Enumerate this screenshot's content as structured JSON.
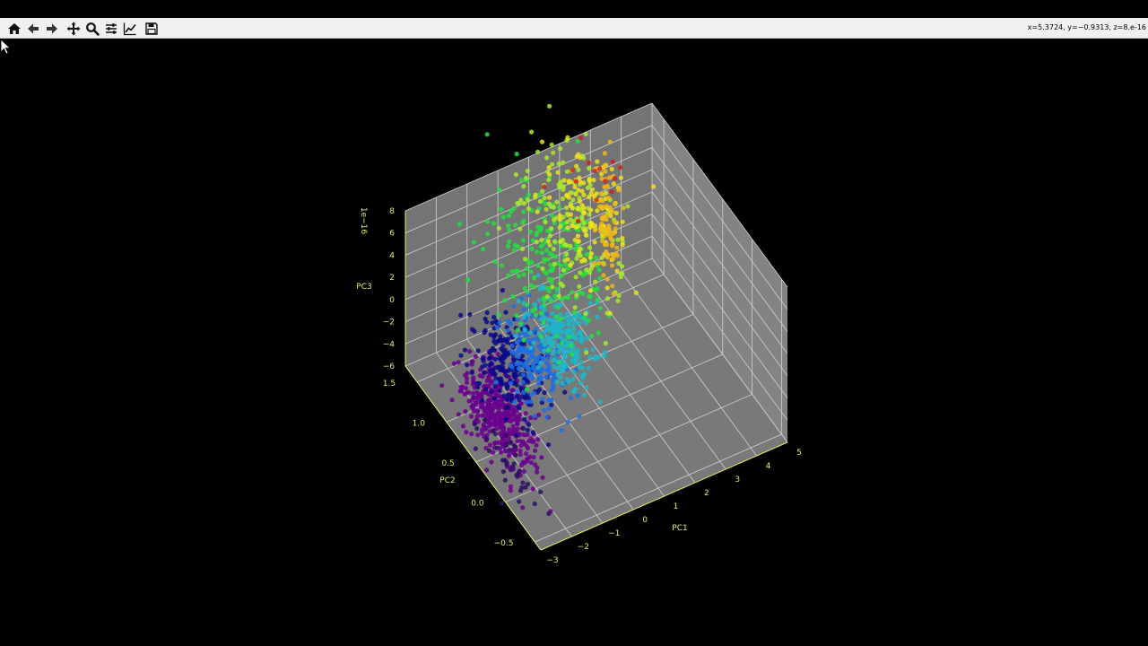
{
  "toolbar": {
    "buttons": [
      {
        "name": "home-icon"
      },
      {
        "name": "back-arrow-icon"
      },
      {
        "name": "forward-arrow-icon"
      },
      {
        "name": "pan-move-icon"
      },
      {
        "name": "zoom-magnifier-icon"
      },
      {
        "name": "configure-subplots-icon"
      },
      {
        "name": "edit-axes-icon"
      },
      {
        "name": "save-floppy-icon"
      }
    ],
    "coords": "x=5.3724, y=−0.9313, z=8.e-16"
  },
  "colors": {
    "axis_text": "#e8e86a",
    "pane": "#808080",
    "grid": "#c8c8c8",
    "background": "#000000",
    "toolbar_bg": "#f0f0f0"
  },
  "chart_data": {
    "type": "scatter",
    "dimensions": 3,
    "xlabel": "PC1",
    "ylabel": "PC2",
    "zlabel": "PC3",
    "z_offset_label": "1e−16",
    "xlim": [
      -3,
      5
    ],
    "ylim": [
      -0.6,
      1.7
    ],
    "zlim": [
      -6,
      8
    ],
    "grid": true,
    "x_ticks": [
      "−3",
      "−2",
      "−1",
      "0",
      "1",
      "2",
      "3",
      "4",
      "5"
    ],
    "y_ticks": [
      "−0.5",
      "0.0",
      "0.5",
      "1.0",
      "1.5"
    ],
    "z_ticks": [
      "−6",
      "−4",
      "−2",
      "0",
      "2",
      "4",
      "6",
      "8"
    ],
    "clusters": [
      {
        "color": "#6a008e",
        "center": [
          -2.2,
          0.55,
          -3
        ],
        "spread": [
          0.35,
          0.25,
          1.5
        ],
        "count": 420
      },
      {
        "color": "#2b1060",
        "center": [
          -2.6,
          0.2,
          -4
        ],
        "spread": [
          0.3,
          0.25,
          1.2
        ],
        "count": 40
      },
      {
        "color": "#0a0a8a",
        "center": [
          -1.3,
          0.85,
          -2
        ],
        "spread": [
          0.4,
          0.25,
          1.5
        ],
        "count": 220
      },
      {
        "color": "#1e6ee0",
        "center": [
          -0.5,
          0.75,
          -1.5
        ],
        "spread": [
          0.35,
          0.2,
          1.5
        ],
        "count": 180
      },
      {
        "color": "#1fb6c8",
        "center": [
          0.3,
          0.75,
          -1
        ],
        "spread": [
          0.35,
          0.2,
          1.5
        ],
        "count": 220
      },
      {
        "color": "#22e040",
        "center": [
          0.9,
          1.3,
          2
        ],
        "spread": [
          0.7,
          0.35,
          3
        ],
        "count": 200
      },
      {
        "color": "#a8ea2a",
        "center": [
          1.8,
          1.4,
          3
        ],
        "spread": [
          0.6,
          0.3,
          3
        ],
        "count": 160
      },
      {
        "color": "#f0e020",
        "center": [
          2.6,
          1.5,
          2
        ],
        "spread": [
          0.45,
          0.25,
          2.5
        ],
        "count": 120
      },
      {
        "color": "#f0b818",
        "center": [
          3.4,
          1.6,
          0
        ],
        "spread": [
          0.12,
          0.06,
          3
        ],
        "count": 70
      },
      {
        "color": "#d02020",
        "center": [
          3.0,
          1.65,
          5
        ],
        "spread": [
          0.5,
          0.1,
          2.5
        ],
        "count": 14
      }
    ]
  }
}
